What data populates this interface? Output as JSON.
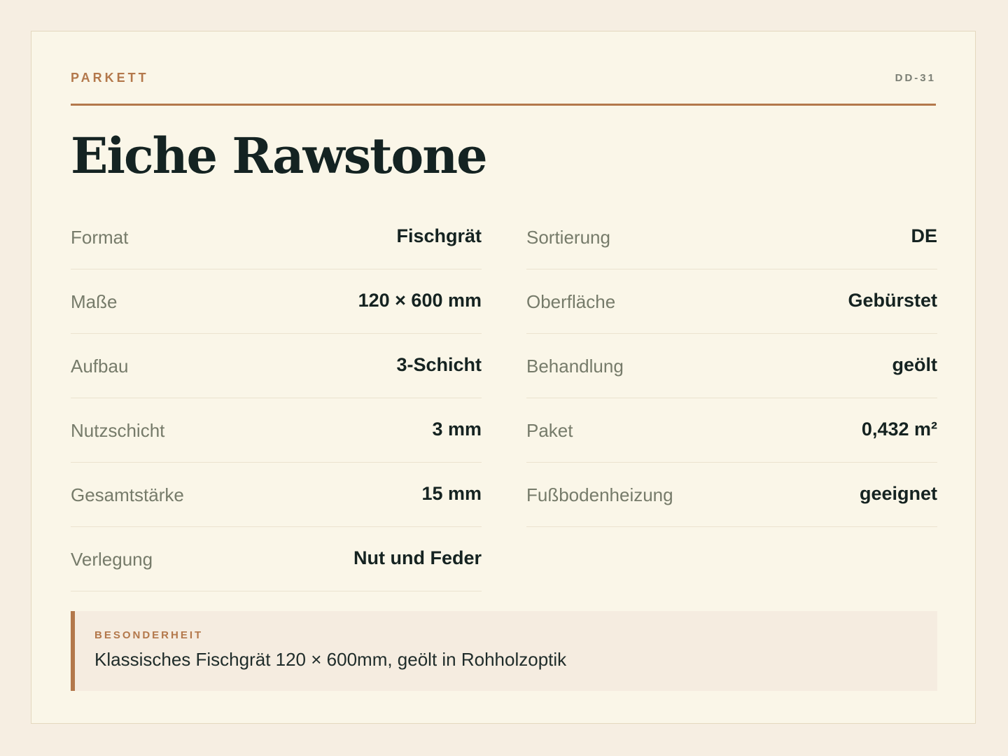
{
  "header": {
    "category": "PARKETT",
    "code": "DD-31"
  },
  "title": "Eiche Rawstone",
  "specs_left": [
    {
      "label": "Format",
      "value": "Fischgrät"
    },
    {
      "label": "Maße",
      "value": "120 × 600 mm"
    },
    {
      "label": "Aufbau",
      "value": "3-Schicht"
    },
    {
      "label": "Nutzschicht",
      "value": "3 mm"
    },
    {
      "label": "Gesamtstärke",
      "value": "15 mm"
    },
    {
      "label": "Verlegung",
      "value": "Nut und Feder"
    }
  ],
  "specs_right": [
    {
      "label": "Sortierung",
      "value": "DE"
    },
    {
      "label": "Oberfläche",
      "value": "Gebürstet"
    },
    {
      "label": "Behandlung",
      "value": "geölt"
    },
    {
      "label": "Paket",
      "value": "0,432 m²"
    },
    {
      "label": "Fußbodenheizung",
      "value": "geeignet"
    }
  ],
  "note": {
    "label": "BESONDERHEIT",
    "text": "Klassisches Fischgrät 120 × 600mm, geölt in Rohholzoptik"
  },
  "colors": {
    "accent": "#b3784b",
    "background": "#f6eee2",
    "card": "#faf6e8",
    "text": "#142322",
    "muted": "#767b6a"
  }
}
